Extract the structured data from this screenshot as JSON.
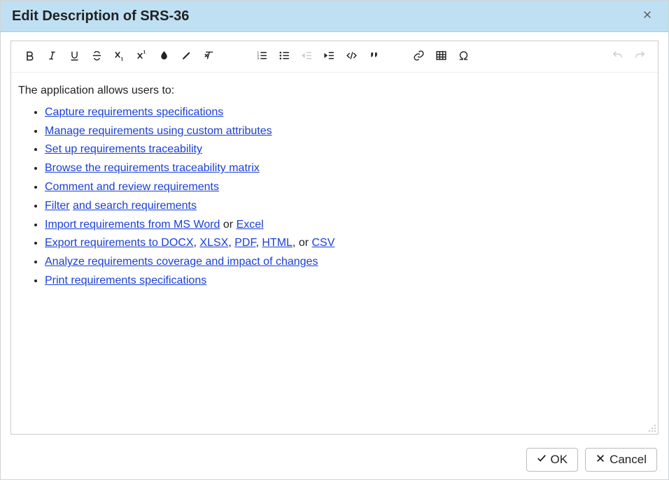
{
  "dialog": {
    "title": "Edit Description of SRS-36"
  },
  "editor": {
    "intro": "The application allows users to:",
    "items": [
      {
        "parts": [
          {
            "t": "link",
            "v": "Capture requirements specifications"
          }
        ]
      },
      {
        "parts": [
          {
            "t": "link",
            "v": "Manage requirements using custom attributes"
          }
        ]
      },
      {
        "parts": [
          {
            "t": "link",
            "v": "Set up requirements traceability"
          }
        ]
      },
      {
        "parts": [
          {
            "t": "link",
            "v": "Browse the requirements traceability matrix"
          }
        ]
      },
      {
        "parts": [
          {
            "t": "link",
            "v": "Comment and review requirements"
          }
        ]
      },
      {
        "parts": [
          {
            "t": "link",
            "v": "Filter"
          },
          {
            "t": "text",
            "v": " "
          },
          {
            "t": "link",
            "v": "and search requirements"
          }
        ]
      },
      {
        "parts": [
          {
            "t": "link",
            "v": "Import requirements from MS Word"
          },
          {
            "t": "text",
            "v": " or "
          },
          {
            "t": "link",
            "v": "Excel"
          }
        ]
      },
      {
        "parts": [
          {
            "t": "link",
            "v": "Export requirements to DOCX"
          },
          {
            "t": "text",
            "v": ", "
          },
          {
            "t": "link",
            "v": "XLSX"
          },
          {
            "t": "text",
            "v": ",  "
          },
          {
            "t": "link",
            "v": "PDF"
          },
          {
            "t": "text",
            "v": ", "
          },
          {
            "t": "link",
            "v": "HTML"
          },
          {
            "t": "text",
            "v": ", or "
          },
          {
            "t": "link",
            "v": "CSV"
          }
        ]
      },
      {
        "parts": [
          {
            "t": "link",
            "v": "Analyze requirements coverage and impact of changes"
          }
        ]
      },
      {
        "parts": [
          {
            "t": "link",
            "v": "Print requirements specifications"
          }
        ]
      }
    ]
  },
  "footer": {
    "ok": "OK",
    "cancel": "Cancel"
  }
}
